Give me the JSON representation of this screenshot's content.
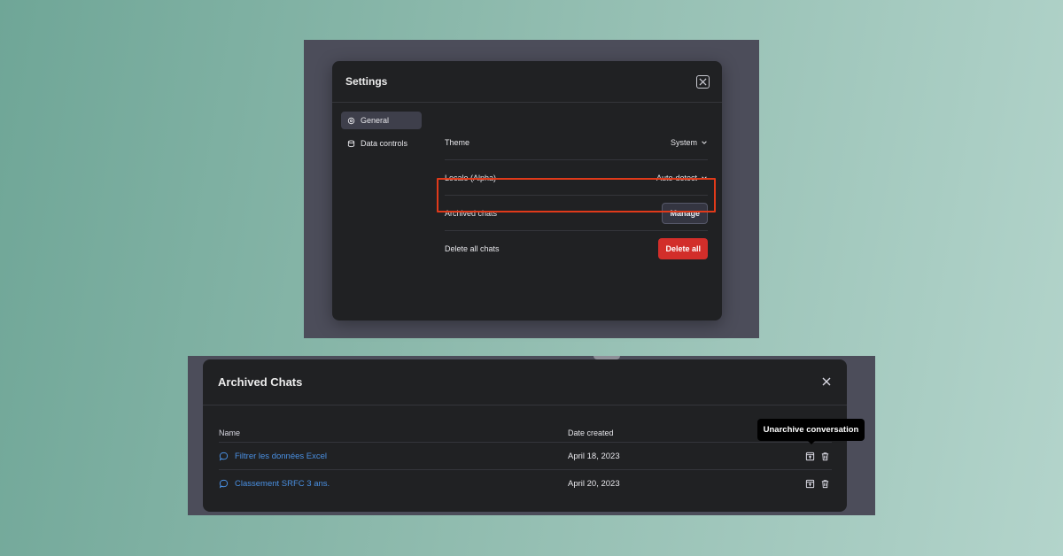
{
  "settings": {
    "title": "Settings",
    "sidebar": [
      {
        "label": "General",
        "icon": "gear-icon",
        "active": true
      },
      {
        "label": "Data controls",
        "icon": "database-icon",
        "active": false
      }
    ],
    "rows": {
      "theme": {
        "label": "Theme",
        "value": "System"
      },
      "locale": {
        "label": "Locale (Alpha)",
        "value": "Auto-detect"
      },
      "archived": {
        "label": "Archived chats",
        "button": "Manage"
      },
      "delete": {
        "label": "Delete all chats",
        "button": "Delete all"
      }
    }
  },
  "archived": {
    "title": "Archived Chats",
    "columns": {
      "name": "Name",
      "date": "Date created"
    },
    "rows": [
      {
        "name": "Filtrer les données Excel",
        "date": "April 18, 2023"
      },
      {
        "name": "Classement SRFC 3 ans.",
        "date": "April 20, 2023"
      }
    ],
    "tooltip": "Unarchive conversation"
  },
  "colors": {
    "accent_link": "#4a90e2",
    "danger": "#d22e2a",
    "highlight": "#e03a1a"
  }
}
